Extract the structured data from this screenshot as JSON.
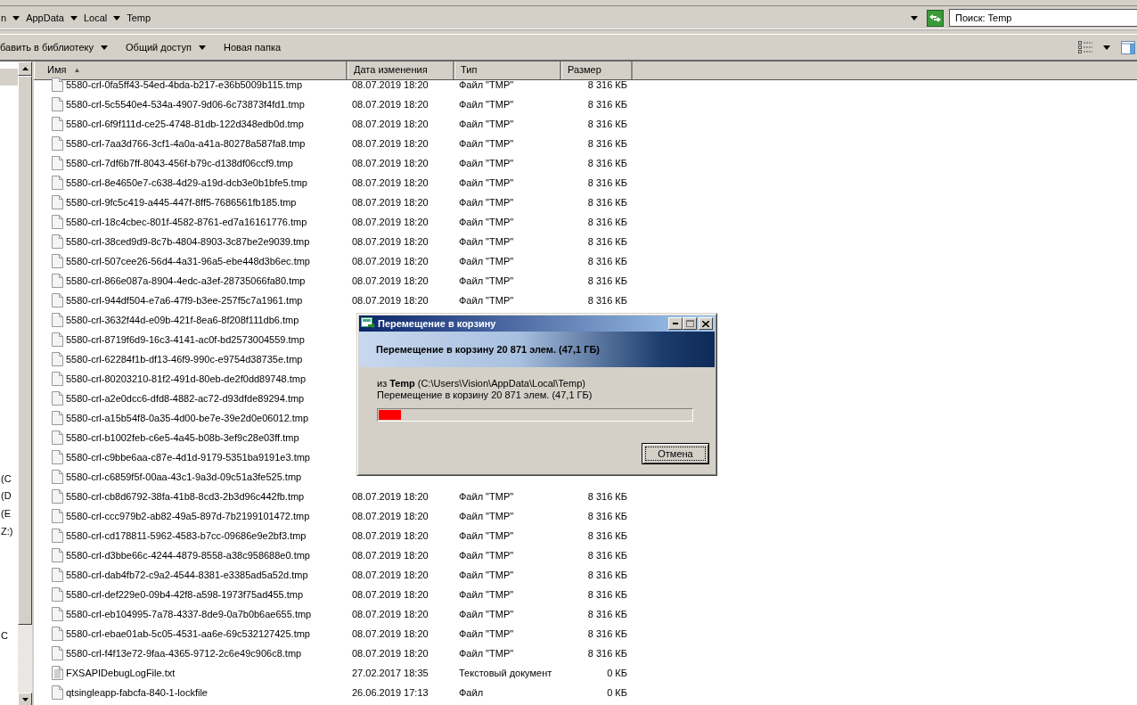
{
  "address_bar": {
    "crumbs": [
      "n",
      "AppData",
      "Local",
      "Temp"
    ],
    "search": {
      "placeholder": "Поиск: Temp"
    }
  },
  "toolbar": {
    "items": [
      {
        "label": "бавить в библиотеку",
        "dropdown": true
      },
      {
        "label": "Общий доступ",
        "dropdown": true
      },
      {
        "label": "Новая папка",
        "dropdown": false
      }
    ]
  },
  "nav_pane": {
    "items": [
      {
        "selected": true
      },
      {
        "label": "(C",
        "selected": false
      },
      {
        "label": "(D",
        "selected": false
      },
      {
        "label": "(E",
        "selected": false
      },
      {
        "label": "Z:)",
        "selected": false
      },
      {
        "label": "C",
        "selected": false
      }
    ]
  },
  "table": {
    "columns": [
      {
        "label": "Имя",
        "sort": "▲"
      },
      {
        "label": "Дата изменения"
      },
      {
        "label": "Тип"
      },
      {
        "label": "Размер"
      }
    ],
    "rows": [
      {
        "kind": "file",
        "name": "5580-crl-0fa5ff43-54ed-4bda-b217-e36b5009b115.tmp",
        "date": "08.07.2019 18:20",
        "type": "Файл \"TMP\"",
        "size": "8 316 КБ"
      },
      {
        "kind": "file",
        "name": "5580-crl-5c5540e4-534a-4907-9d06-6c73873f4fd1.tmp",
        "date": "08.07.2019 18:20",
        "type": "Файл \"TMP\"",
        "size": "8 316 КБ"
      },
      {
        "kind": "file",
        "name": "5580-crl-6f9f111d-ce25-4748-81db-122d348edb0d.tmp",
        "date": "08.07.2019 18:20",
        "type": "Файл \"TMP\"",
        "size": "8 316 КБ"
      },
      {
        "kind": "file",
        "name": "5580-crl-7aa3d766-3cf1-4a0a-a41a-80278a587fa8.tmp",
        "date": "08.07.2019 18:20",
        "type": "Файл \"TMP\"",
        "size": "8 316 КБ"
      },
      {
        "kind": "file",
        "name": "5580-crl-7df6b7ff-8043-456f-b79c-d138df06ccf9.tmp",
        "date": "08.07.2019 18:20",
        "type": "Файл \"TMP\"",
        "size": "8 316 КБ"
      },
      {
        "kind": "file",
        "name": "5580-crl-8e4650e7-c638-4d29-a19d-dcb3e0b1bfe5.tmp",
        "date": "08.07.2019 18:20",
        "type": "Файл \"TMP\"",
        "size": "8 316 КБ"
      },
      {
        "kind": "file",
        "name": "5580-crl-9fc5c419-a445-447f-8ff5-7686561fb185.tmp",
        "date": "08.07.2019 18:20",
        "type": "Файл \"TMP\"",
        "size": "8 316 КБ"
      },
      {
        "kind": "file",
        "name": "5580-crl-18c4cbec-801f-4582-8761-ed7a16161776.tmp",
        "date": "08.07.2019 18:20",
        "type": "Файл \"TMP\"",
        "size": "8 316 КБ"
      },
      {
        "kind": "file",
        "name": "5580-crl-38ced9d9-8c7b-4804-8903-3c87be2e9039.tmp",
        "date": "08.07.2019 18:20",
        "type": "Файл \"TMP\"",
        "size": "8 316 КБ"
      },
      {
        "kind": "file",
        "name": "5580-crl-507cee26-56d4-4a31-96a5-ebe448d3b6ec.tmp",
        "date": "08.07.2019 18:20",
        "type": "Файл \"TMP\"",
        "size": "8 316 КБ"
      },
      {
        "kind": "file",
        "name": "5580-crl-866e087a-8904-4edc-a3ef-28735066fa80.tmp",
        "date": "08.07.2019 18:20",
        "type": "Файл \"TMP\"",
        "size": "8 316 КБ"
      },
      {
        "kind": "file",
        "name": "5580-crl-944df504-e7a6-47f9-b3ee-257f5c7a1961.tmp",
        "date": "08.07.2019 18:20",
        "type": "Файл \"TMP\"",
        "size": "8 316 КБ"
      },
      {
        "kind": "file",
        "name": "5580-crl-3632f44d-e09b-421f-8ea6-8f208f111db6.tmp"
      },
      {
        "kind": "file",
        "name": "5580-crl-8719f6d9-16c3-4141-ac0f-bd2573004559.tmp"
      },
      {
        "kind": "file",
        "name": "5580-crl-62284f1b-df13-46f9-990c-e9754d38735e.tmp"
      },
      {
        "kind": "file",
        "name": "5580-crl-80203210-81f2-491d-80eb-de2f0dd89748.tmp"
      },
      {
        "kind": "file",
        "name": "5580-crl-a2e0dcc6-dfd8-4882-ac72-d93dfde89294.tmp"
      },
      {
        "kind": "file",
        "name": "5580-crl-a15b54f8-0a35-4d00-be7e-39e2d0e06012.tmp"
      },
      {
        "kind": "file",
        "name": "5580-crl-b1002feb-c6e5-4a45-b08b-3ef9c28e03ff.tmp"
      },
      {
        "kind": "file",
        "name": "5580-crl-c9bbe6aa-c87e-4d1d-9179-5351ba9191e3.tmp"
      },
      {
        "kind": "file",
        "name": "5580-crl-c6859f5f-00aa-43c1-9a3d-09c51a3fe525.tmp"
      },
      {
        "kind": "file",
        "name": "5580-crl-cb8d6792-38fa-41b8-8cd3-2b3d96c442fb.tmp",
        "date": "08.07.2019 18:20",
        "type": "Файл \"TMP\"",
        "size": "8 316 КБ"
      },
      {
        "kind": "file",
        "name": "5580-crl-ccc979b2-ab82-49a5-897d-7b2199101472.tmp",
        "date": "08.07.2019 18:20",
        "type": "Файл \"TMP\"",
        "size": "8 316 КБ"
      },
      {
        "kind": "file",
        "name": "5580-crl-cd178811-5962-4583-b7cc-09686e9e2bf3.tmp",
        "date": "08.07.2019 18:20",
        "type": "Файл \"TMP\"",
        "size": "8 316 КБ"
      },
      {
        "kind": "file",
        "name": "5580-crl-d3bbe66c-4244-4879-8558-a38c958688e0.tmp",
        "date": "08.07.2019 18:20",
        "type": "Файл \"TMP\"",
        "size": "8 316 КБ"
      },
      {
        "kind": "file",
        "name": "5580-crl-dab4fb72-c9a2-4544-8381-e3385ad5a52d.tmp",
        "date": "08.07.2019 18:20",
        "type": "Файл \"TMP\"",
        "size": "8 316 КБ"
      },
      {
        "kind": "file",
        "name": "5580-crl-def229e0-09b4-42f8-a598-1973f75ad455.tmp",
        "date": "08.07.2019 18:20",
        "type": "Файл \"TMP\"",
        "size": "8 316 КБ"
      },
      {
        "kind": "file",
        "name": "5580-crl-eb104995-7a78-4337-8de9-0a7b0b6ae655.tmp",
        "date": "08.07.2019 18:20",
        "type": "Файл \"TMP\"",
        "size": "8 316 КБ"
      },
      {
        "kind": "file",
        "name": "5580-crl-ebae01ab-5c05-4531-aa6e-69c532127425.tmp",
        "date": "08.07.2019 18:20",
        "type": "Файл \"TMP\"",
        "size": "8 316 КБ"
      },
      {
        "kind": "file",
        "name": "5580-crl-f4f13e72-9faa-4365-9712-2c6e49c906c8.tmp",
        "date": "08.07.2019 18:20",
        "type": "Файл \"TMP\"",
        "size": "8 316 КБ"
      },
      {
        "kind": "text",
        "name": "FXSAPIDebugLogFile.txt",
        "date": "27.02.2017 18:35",
        "type": "Текстовый документ",
        "size": "0 КБ"
      },
      {
        "kind": "file",
        "name": "qtsingleapp-fabcfa-840-1-lockfile",
        "date": "26.06.2019 17:13",
        "type": "Файл",
        "size": "0 КБ"
      }
    ]
  },
  "dialog": {
    "title": "Перемещение в корзину",
    "heading": "Перемещение в корзину 20 871 элем. (47,1 ГБ)",
    "source": "из **Temp** (C:\\Users\\Vision\\AppData\\Local\\Temp)",
    "status": "Перемещение в корзину 20 871 элем. (47,1 ГБ)",
    "progress": {
      "level": 0.07
    },
    "buttons": [
      "Отмена"
    ]
  }
}
